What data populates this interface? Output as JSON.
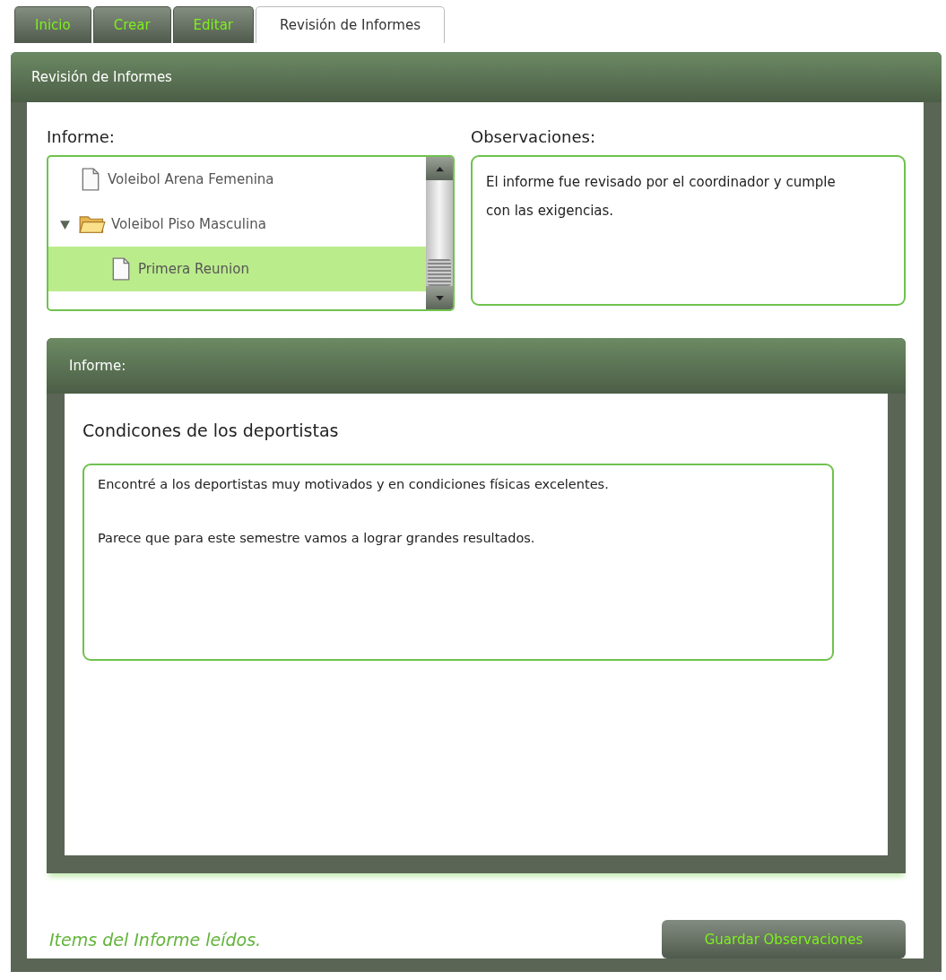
{
  "tabs": [
    {
      "label": "Inicio",
      "selected": false
    },
    {
      "label": "Crear",
      "selected": false
    },
    {
      "label": "Editar",
      "selected": false
    },
    {
      "label": "Revisión de Informes",
      "selected": true
    }
  ],
  "panel": {
    "title": "Revisión de Informes"
  },
  "report_tree": {
    "label": "Informe:",
    "items": [
      {
        "kind": "file",
        "label": "Voleibol Arena Femenina",
        "selected": false
      },
      {
        "kind": "folder",
        "label": "Voleibol Piso Masculina",
        "selected": false,
        "expanded": true,
        "children": [
          {
            "kind": "file",
            "label": "Primera Reunion",
            "selected": true
          }
        ]
      }
    ]
  },
  "observations": {
    "label": "Observaciones:",
    "value": "El informe fue revisado por el coordinador y cumple con las exigencias."
  },
  "report": {
    "title": "Informe:",
    "section_title": "Condicones de los deportistas",
    "paragraphs": [
      "Encontré a los deportistas muy motivados y en condiciones físicas excelentes.",
      "Parece que para este semestre vamos a lograr grandes resultados."
    ]
  },
  "status": "Items del Informe leídos.",
  "save_button": "Guardar Observaciones"
}
